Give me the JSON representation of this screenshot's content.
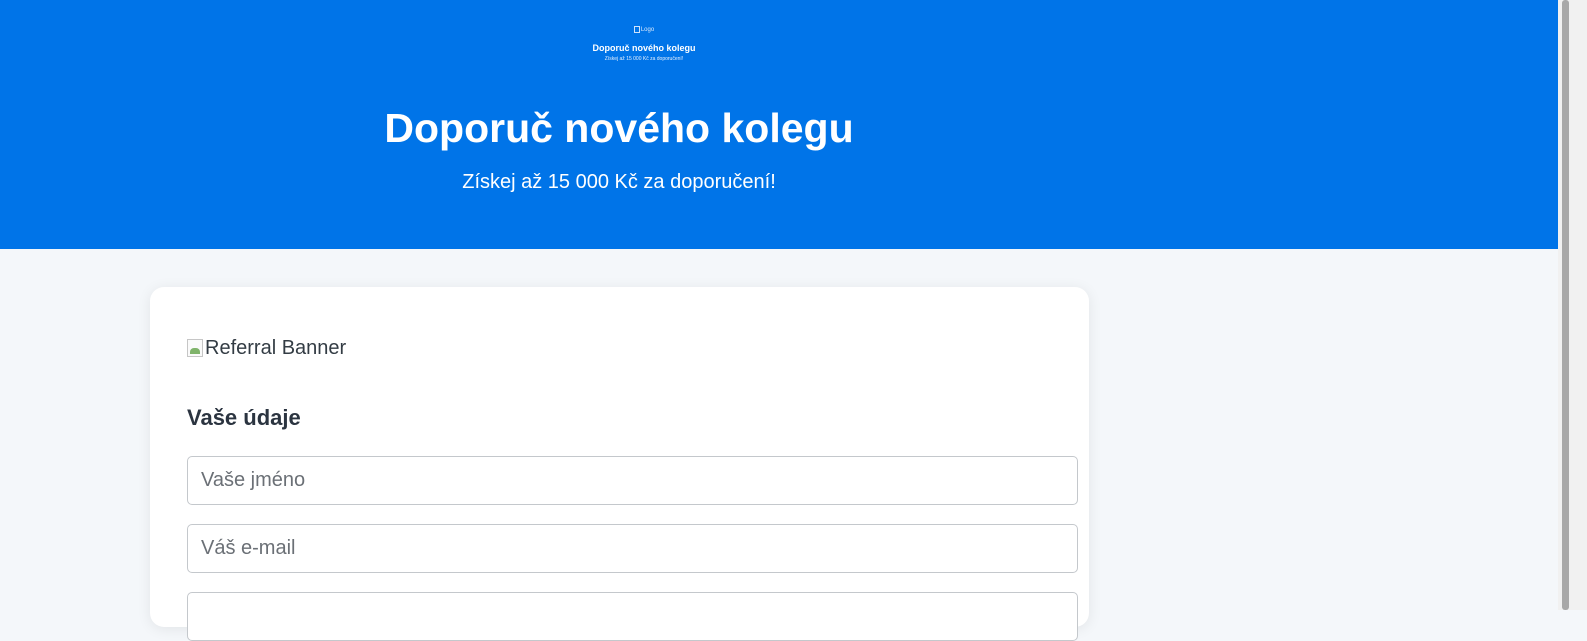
{
  "mini_header": {
    "logo_alt": "Logo",
    "title": "Doporuč nového kolegu",
    "subtitle": "Získej až 15 000 Kč za doporučení!"
  },
  "hero": {
    "title": "Doporuč nového kolegu",
    "subtitle": "Získej až 15 000 Kč za doporučení!"
  },
  "card": {
    "banner_alt": "Referral Banner",
    "section_title": "Vaše údaje",
    "fields": {
      "name_placeholder": "Vaše jméno",
      "email_placeholder": "Váš e-mail",
      "third_placeholder": ""
    }
  },
  "colors": {
    "hero_bg": "#0074e8",
    "page_bg": "#f4f7fa",
    "card_bg": "#ffffff",
    "text_dark": "#2b3440"
  }
}
